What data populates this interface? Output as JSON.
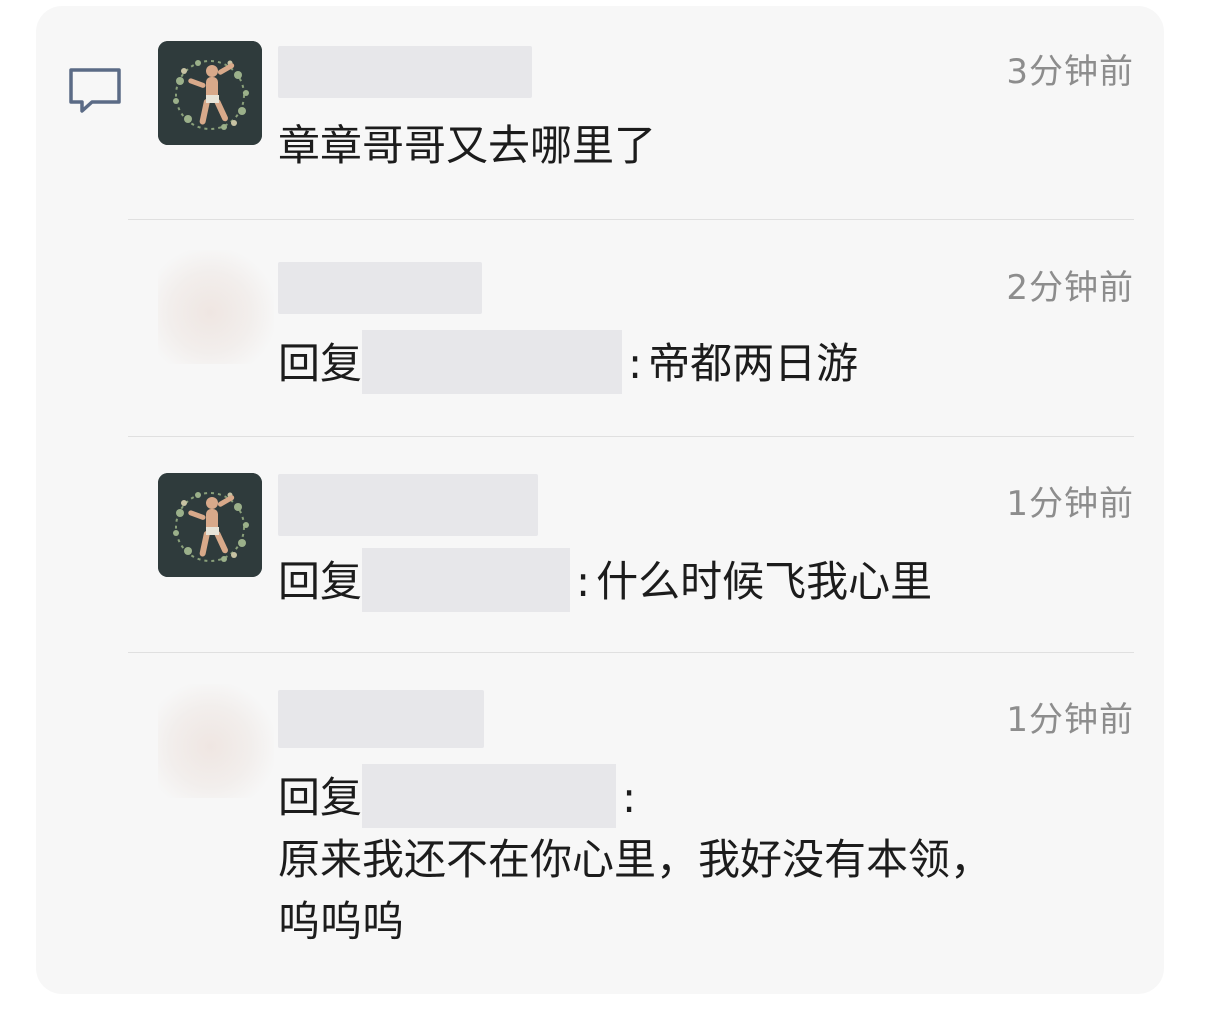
{
  "colors": {
    "card_background": "#f7f7f7",
    "accent_icon": "#5b6b86",
    "time_text": "#8d8d8d",
    "blur_placeholder": "#e7e7ea"
  },
  "icons": {
    "comment": "comment-bubble-icon"
  },
  "comments": [
    {
      "time": "3分钟前",
      "text": "章章哥哥又去哪里了",
      "has_avatar": true
    },
    {
      "time": "2分钟前",
      "reply_prefix": "回复",
      "colon": ":",
      "text": "帝都两日游",
      "has_avatar": false
    },
    {
      "time": "1分钟前",
      "reply_prefix": "回复",
      "colon": ":",
      "text": "什么时候飞我心里",
      "has_avatar": true
    },
    {
      "time": "1分钟前",
      "reply_prefix": "回复",
      "colon": ":",
      "text_line1": "原来我还不在你心里，我好没有本领，",
      "text_line2": "呜呜呜",
      "has_avatar": false
    }
  ]
}
